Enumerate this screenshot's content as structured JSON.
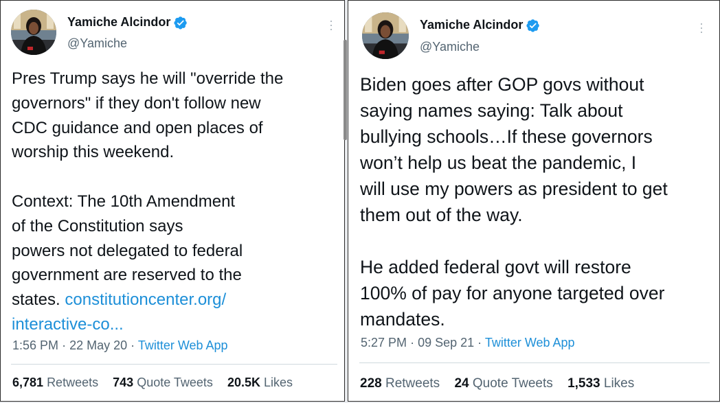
{
  "tweets": [
    {
      "author": {
        "name": "Yamiche Alcindor",
        "handle": "@Yamiche",
        "verified_icon": "verified-badge-icon"
      },
      "paragraphs": [
        [
          "Pres Trump says he will \"override the",
          "governors\" if they don't follow new",
          "CDC guidance and open places of",
          "worship this weekend."
        ],
        [
          "Context: The 10th Amendment",
          "of the Constitution says",
          "powers not delegated to federal",
          "government are reserved to the"
        ]
      ],
      "last_line_prefix": "states. ",
      "link_line1": "constitutioncenter.org/",
      "link_line2": "interactive-co...",
      "time": "1:56 PM",
      "date": "22 May 20",
      "source": "Twitter Web App",
      "stats": {
        "retweets_count": "6,781",
        "retweets_label": "Retweets",
        "quotes_count": "743",
        "quotes_label": "Quote Tweets",
        "likes_count": "20.5K",
        "likes_label": "Likes"
      }
    },
    {
      "author": {
        "name": "Yamiche Alcindor",
        "handle": "@Yamiche",
        "verified_icon": "verified-badge-icon"
      },
      "paragraphs": [
        [
          "Biden goes after GOP govs without",
          "saying names saying: Talk about",
          "bullying schools…If these governors",
          "won’t help us beat the pandemic, I",
          "will use my powers as president to get",
          "them out of the way."
        ],
        [
          "He added federal govt will restore",
          "100% of pay for anyone targeted over",
          "mandates."
        ]
      ],
      "time": "5:27 PM",
      "date": "09 Sep 21",
      "source": "Twitter Web App",
      "stats": {
        "retweets_count": "228",
        "retweets_label": "Retweets",
        "quotes_count": "24",
        "quotes_label": "Quote Tweets",
        "likes_count": "1,533",
        "likes_label": "Likes"
      }
    }
  ],
  "colors": {
    "link": "#1d8fd8",
    "text": "#0f1419",
    "muted": "#536471",
    "verified": "#1d9bf0"
  }
}
